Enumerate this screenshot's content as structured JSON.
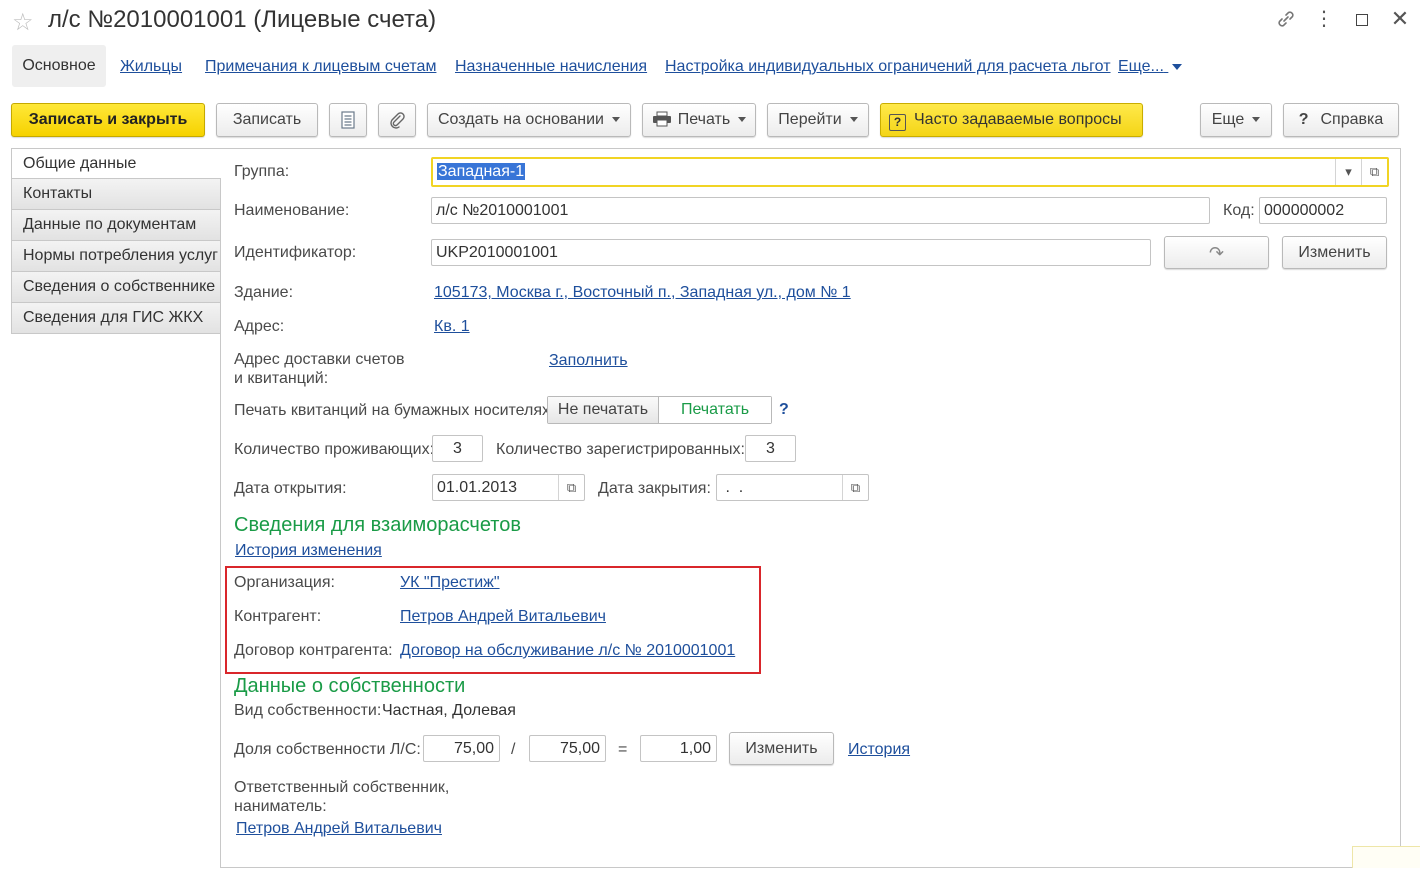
{
  "window": {
    "title": "л/с №2010001001 (Лицевые счета)"
  },
  "nav": {
    "active": "Основное",
    "links": [
      "Жильцы",
      "Примечания к лицевым счетам",
      "Назначенные начисления",
      "Настройка индивидуальных ограничений для расчета льгот",
      "Еще..."
    ]
  },
  "toolbar": {
    "save_close": "Записать и закрыть",
    "save": "Записать",
    "create_based": "Создать на основании",
    "print": "Печать",
    "goto": "Перейти",
    "faq": "Часто задаваемые вопросы",
    "more": "Еще",
    "help": "Справка"
  },
  "tabs": [
    "Общие данные",
    "Контакты",
    "Данные по документам",
    "Нормы потребления услуг",
    "Сведения о собственнике",
    "Сведения для ГИС ЖКХ"
  ],
  "form": {
    "group_label": "Группа:",
    "group_value": "Западная-1",
    "name_label": "Наименование:",
    "name_value": "л/с №2010001001",
    "code_label": "Код:",
    "code_value": "000000002",
    "id_label": "Идентификатор:",
    "id_value": "UKP2010001001",
    "change_button": "Изменить",
    "building_label": "Здание:",
    "building_value": "105173, Москва г., Восточный п., Западная ул., дом № 1",
    "address_label": "Адрес:",
    "address_value": "Кв. 1",
    "delivery_label_1": "Адрес доставки счетов",
    "delivery_label_2": "и квитанций:",
    "delivery_fill": "Заполнить",
    "paper_label": "Печать квитанций на бумажных носителях:",
    "paper_no": "Не печатать",
    "paper_yes": "Печатать",
    "paper_help": "?",
    "residents_label": "Количество проживающих:",
    "residents_value": "3",
    "registered_label": "Количество зарегистрированных:",
    "registered_value": "3",
    "open_date_label": "Дата открытия:",
    "open_date_value": "01.01.2013",
    "close_date_label": "Дата закрытия:",
    "close_date_value": " .  ."
  },
  "settlements": {
    "heading": "Сведения для взаиморасчетов",
    "history_link": "История изменения",
    "org_label": "Организация:",
    "org_value": "УК \"Престиж\"",
    "contractor_label": "Контрагент:",
    "contractor_value": "Петров Андрей Витальевич",
    "contract_label": "Договор контрагента:",
    "contract_value": "Договор на обслуживание л/с № 2010001001"
  },
  "ownership": {
    "heading": "Данные о собственности",
    "type_label": "Вид собственности:",
    "type_value": "Частная, Долевая",
    "share_label": "Доля собственности Л/С:",
    "share_num": "75,00",
    "share_slash": "/",
    "share_den": "75,00",
    "share_eq": "=",
    "share_result": "1,00",
    "change_button": "Изменить",
    "history_link": "История",
    "responsible_label_1": "Ответственный собственник,",
    "responsible_label_2": "наниматель:",
    "responsible_value": "Петров Андрей Витальевич"
  },
  "colors": {
    "accent_yellow": "#f6d200",
    "section_green": "#1a9b47",
    "link_blue": "#1e4f9c",
    "highlight_red": "#d9262b"
  }
}
